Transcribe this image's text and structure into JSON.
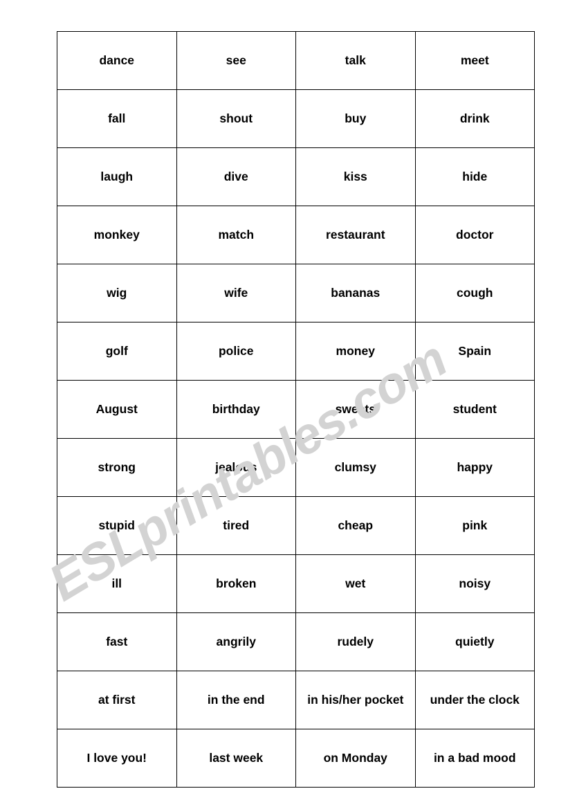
{
  "document": {
    "type": "worksheet",
    "watermark": {
      "text": "ESLprintables.com",
      "color": "#d3d3d3"
    },
    "table": {
      "columns": 4,
      "rows": 13,
      "border_color": "#000000",
      "text_color": "#000000",
      "cells": [
        [
          "dance",
          "see",
          "talk",
          "meet"
        ],
        [
          "fall",
          "shout",
          "buy",
          "drink"
        ],
        [
          "laugh",
          "dive",
          "kiss",
          "hide"
        ],
        [
          "monkey",
          "match",
          "restaurant",
          "doctor"
        ],
        [
          "wig",
          "wife",
          "bananas",
          "cough"
        ],
        [
          "golf",
          "police",
          "money",
          "Spain"
        ],
        [
          "August",
          "birthday",
          "sweets",
          "student"
        ],
        [
          "strong",
          "jealous",
          "clumsy",
          "happy"
        ],
        [
          "stupid",
          "tired",
          "cheap",
          "pink"
        ],
        [
          "ill",
          "broken",
          "wet",
          "noisy"
        ],
        [
          "fast",
          "angrily",
          "rudely",
          "quietly"
        ],
        [
          "at first",
          "in the end",
          "in his/her pocket",
          "under the clock"
        ],
        [
          "I love you!",
          "last week",
          "on Monday",
          "in a bad mood"
        ]
      ]
    }
  }
}
